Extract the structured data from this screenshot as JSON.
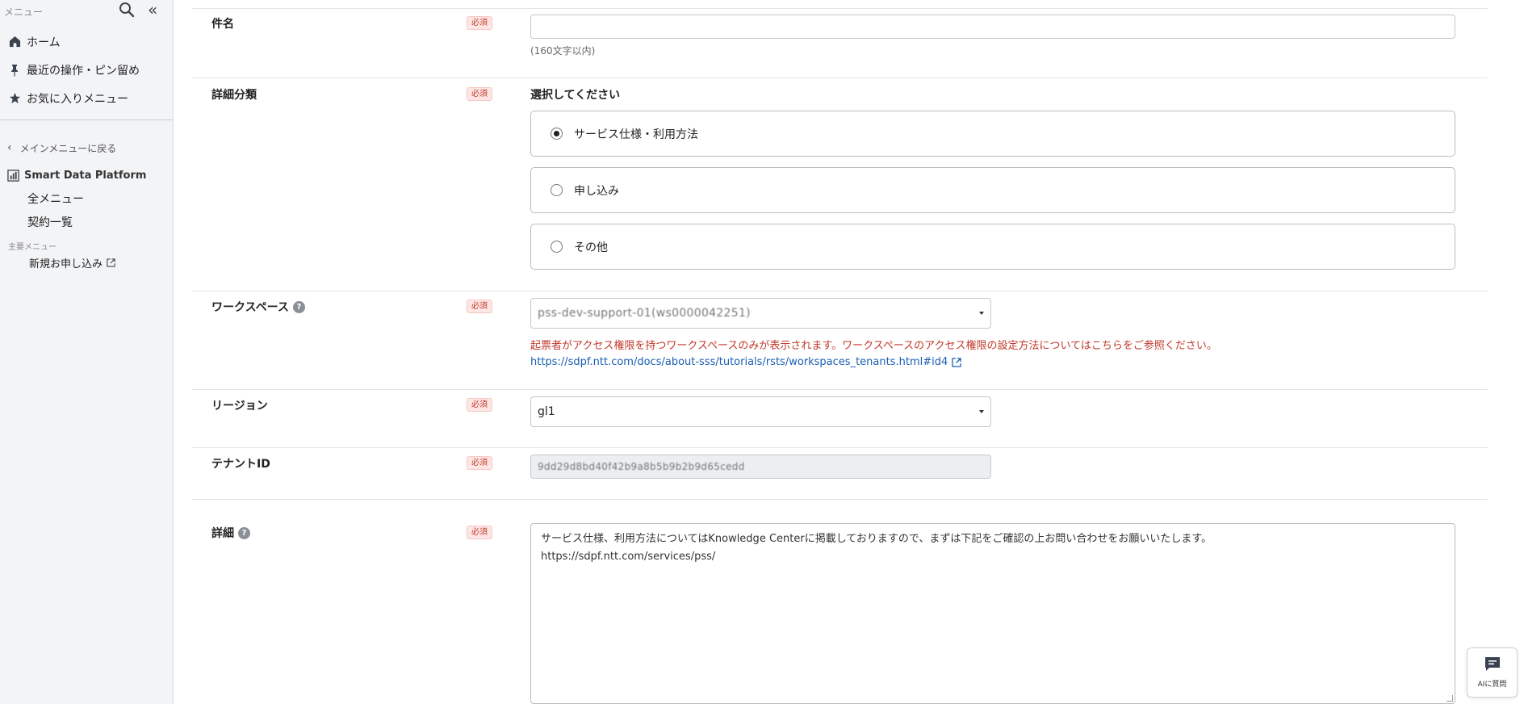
{
  "sidebar": {
    "title": "メニュー",
    "items": [
      {
        "label": "ホーム",
        "icon": "home-icon"
      },
      {
        "label": "最近の操作・ピン留め",
        "icon": "pin-icon"
      },
      {
        "label": "お気に入りメニュー",
        "icon": "star-icon"
      }
    ],
    "back_label": "メインメニューに戻る",
    "product": "Smart Data Platform",
    "sub_items": [
      "全メニュー",
      "契約一覧"
    ],
    "section_label": "主要メニュー",
    "section_items": [
      "新規お申し込み"
    ]
  },
  "form": {
    "required_badge": "必須",
    "subject": {
      "label": "件名",
      "value": "",
      "hint": "(160文字以内)"
    },
    "category": {
      "label": "詳細分類",
      "prompt": "選択してください",
      "options": [
        {
          "label": "サービス仕様・利用方法",
          "selected": true
        },
        {
          "label": "申し込み",
          "selected": false
        },
        {
          "label": "その他",
          "selected": false
        }
      ]
    },
    "workspace": {
      "label": "ワークスペース",
      "value": "pss-dev-support-01(ws0000042251)",
      "error": "起票者がアクセス権限を持つワークスペースのみが表示されます。ワークスペースのアクセス権限の設定方法についてはこちらをご参照ください。",
      "link": "https://sdpf.ntt.com/docs/about-sss/tutorials/rsts/workspaces_tenants.html#id4"
    },
    "region": {
      "label": "リージョン",
      "value": "gl1"
    },
    "tenant": {
      "label": "テナントID",
      "value": "9dd29d8bd40f42b9a8b5b9b2b9d65cedd"
    },
    "detail": {
      "label": "詳細",
      "line1": "サービス仕様、利用方法についてはKnowledge Centerに掲載しておりますので、まずは下記をご確認の上お問い合わせをお願いいたします。",
      "line2": "https://sdpf.ntt.com/services/pss/"
    }
  },
  "ai_button": {
    "label": "AIに質問"
  }
}
